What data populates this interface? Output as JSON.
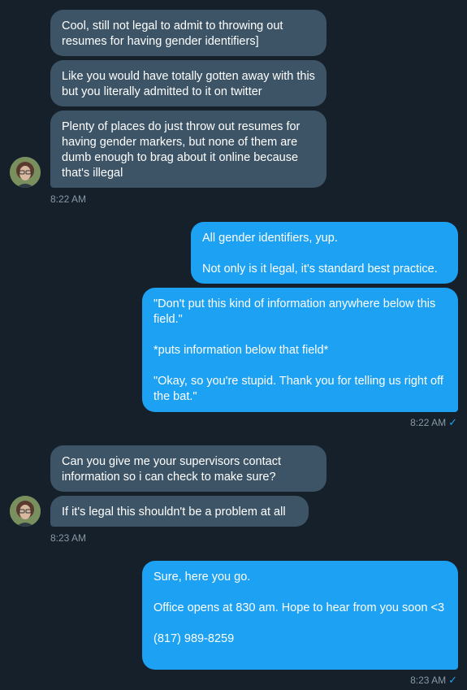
{
  "messages": {
    "m1": "Cool, still not legal to admit to throwing out resumes for having gender identifiers]",
    "m2": "Like you would have totally gotten away with this but you literally admitted to it on twitter",
    "m3": "Plenty of places do just throw out resumes for having gender markers, but none of them are dumb enough to brag about it online because that's illegal",
    "m4": "All gender identifiers, yup.\n\nNot only is it legal, it's standard best practice.",
    "m5": "\"Don't put this kind of information anywhere below this field.\"\n\n*puts information below that field*\n\n\"Okay, so you're stupid. Thank you for telling us right off the bat.\"",
    "m6": "Can you give me your supervisors contact information so i can check to make sure?",
    "m7": "If it's legal this shouldn't be a problem at all",
    "m8": "Sure, here you go.\n\nOffice opens at 830 am. Hope to hear from you soon <3\n\n(817) 989-8259"
  },
  "timestamps": {
    "t1": "8:22 AM",
    "t2": "8:22 AM",
    "t3": "8:23 AM",
    "t4": "8:23 AM"
  },
  "icons": {
    "read_receipt": "check-icon"
  },
  "colors": {
    "background": "#15202b",
    "incoming_bubble": "#3d5466",
    "outgoing_bubble": "#1da1f2",
    "timestamp": "#8899a6"
  }
}
